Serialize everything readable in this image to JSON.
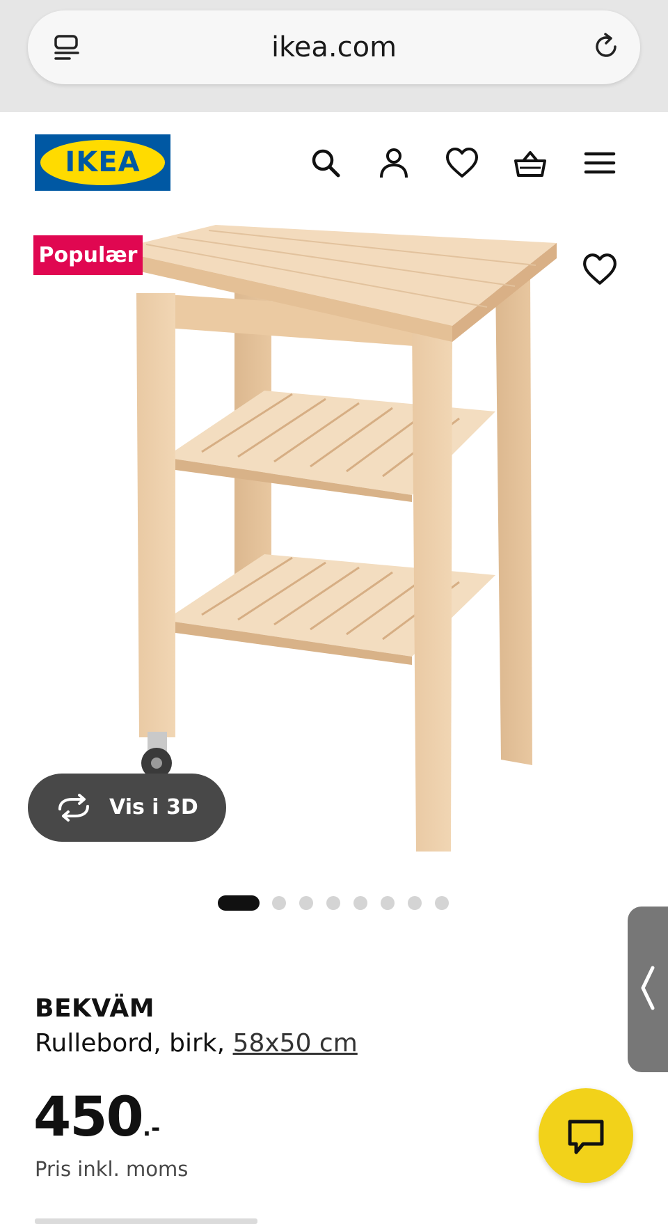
{
  "browser": {
    "url": "ikea.com",
    "icons": {
      "tabs": "tabs-icon",
      "reload": "reload-icon"
    }
  },
  "header": {
    "logo_text": "IKEA",
    "icons": [
      "search-icon",
      "user-icon",
      "heart-icon",
      "basket-icon",
      "menu-icon"
    ],
    "colors": {
      "logo_blue": "#0058a3",
      "logo_yellow": "#ffdb00"
    }
  },
  "media": {
    "badge": "Populær",
    "badge_color": "#e00751",
    "view_3d_label": "Vis i 3D",
    "image_count": 8,
    "active_image_index": 0
  },
  "product": {
    "name": "BEKVÄM",
    "description": "Rullebord, birk,",
    "size": "58x50 cm",
    "price_integer": "450",
    "price_suffix": ".-",
    "price_note": "Pris inkl. moms"
  },
  "chat": {
    "icon": "chat-icon",
    "color": "#f2d21a"
  }
}
